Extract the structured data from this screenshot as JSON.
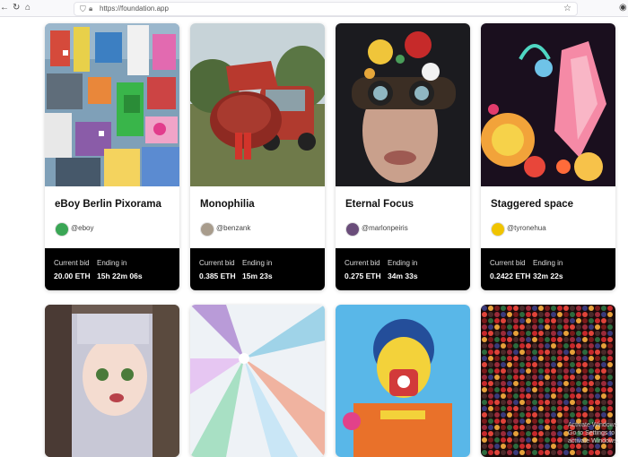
{
  "browser": {
    "url": "https://foundation.app",
    "back_icon": "back-arrow-icon",
    "reload_icon": "reload-icon",
    "home_icon": "home-icon"
  },
  "cards": [
    {
      "title": "eBoy Berlin Pixorama",
      "handle": "@eboy",
      "bid_label": "Current bid",
      "bid": "20.00 ETH",
      "ending_label": "Ending in",
      "ending": "15h  22m  06s"
    },
    {
      "title": "Monophilia",
      "handle": "@benzank",
      "bid_label": "Current bid",
      "bid": "0.385 ETH",
      "ending_label": "Ending in",
      "ending": "15m  23s"
    },
    {
      "title": "Eternal Focus",
      "handle": "@marlonpeiris",
      "bid_label": "Current bid",
      "bid": "0.275 ETH",
      "ending_label": "Ending in",
      "ending": "34m 33s"
    },
    {
      "title": "Staggered space",
      "handle": "@tyronehua",
      "bid_label": "Current bid",
      "bid": "0.2422 ETH",
      "ending_label": "Ending in",
      "ending": "32m 22s"
    }
  ],
  "watermark": {
    "line1": "Activate Windows",
    "line2": "Go to Settings to activate Windows."
  }
}
